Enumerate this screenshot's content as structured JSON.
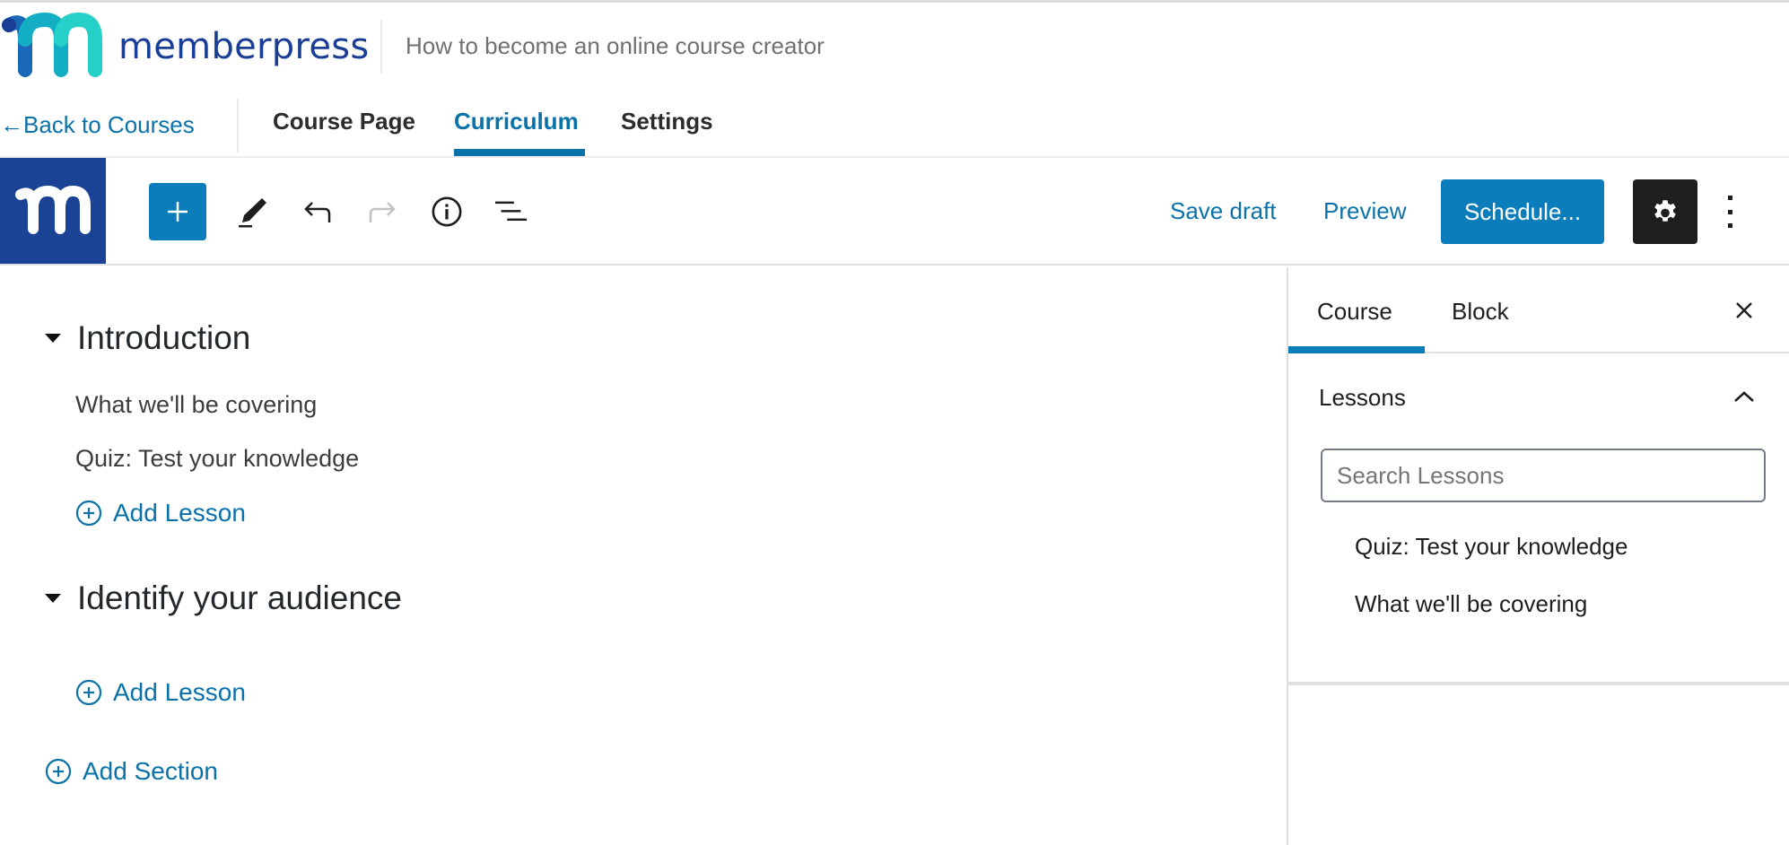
{
  "header": {
    "brand_name": "memberpress",
    "course_title": "How to become an online course creator"
  },
  "nav": {
    "back_label": "←Back to Courses",
    "tabs": [
      {
        "label": "Course Page",
        "active": false
      },
      {
        "label": "Curriculum",
        "active": true
      },
      {
        "label": "Settings",
        "active": false
      }
    ]
  },
  "toolbar": {
    "icons": [
      "memberpress-logo-icon",
      "plus-icon",
      "pencil-icon",
      "undo-icon",
      "redo-icon",
      "info-icon",
      "list-view-icon",
      "gear-icon",
      "more-vertical-icon"
    ],
    "save_draft_label": "Save draft",
    "preview_label": "Preview",
    "schedule_label": "Schedule...",
    "redo_disabled": true,
    "accent_color": "#0a7dba"
  },
  "curriculum": {
    "sections": [
      {
        "title": "Introduction",
        "lessons": [
          "What we'll be covering",
          "Quiz: Test your knowledge"
        ],
        "add_lesson_label": "Add Lesson"
      },
      {
        "title": "Identify your audience",
        "lessons": [],
        "add_lesson_label": "Add Lesson"
      }
    ],
    "add_section_label": "Add Section"
  },
  "sidebar": {
    "tabs": [
      {
        "label": "Course",
        "active": true
      },
      {
        "label": "Block",
        "active": false
      }
    ],
    "panel": {
      "title": "Lessons",
      "expanded": true,
      "search_placeholder": "Search Lessons",
      "search_value": "",
      "lessons": [
        "Quiz: Test your knowledge",
        "What we'll be covering"
      ]
    }
  }
}
